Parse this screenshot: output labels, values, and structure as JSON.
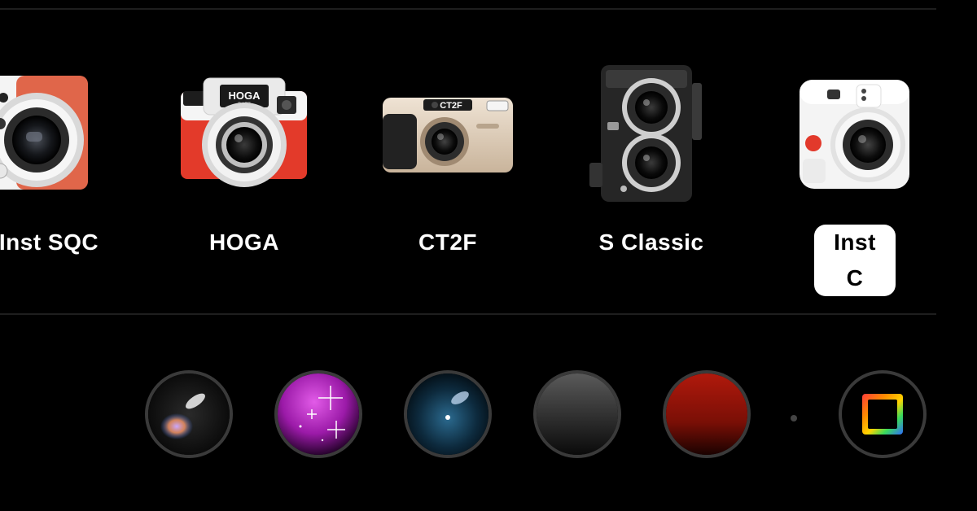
{
  "cameras": [
    {
      "id": "inst-sqc",
      "label": "Inst SQC",
      "selected": false
    },
    {
      "id": "hoga",
      "label": "HOGA",
      "badge": "HOGA",
      "selected": false
    },
    {
      "id": "ct2f",
      "label": "CT2F",
      "badge": "CT2F",
      "selected": false
    },
    {
      "id": "s-classic",
      "label": "S Classic",
      "selected": false
    },
    {
      "id": "inst-c",
      "label": "Inst C",
      "selected": true
    }
  ],
  "filters": [
    {
      "name": "light-leak-lens-filter",
      "icon": "iridescent-glare-icon"
    },
    {
      "name": "sparkle-lens-filter",
      "icon": "purple-sparkle-icon"
    },
    {
      "name": "blue-star-lens-filter",
      "icon": "blue-lens-icon"
    },
    {
      "name": "gray-lens-filter",
      "icon": "gray-lens-icon"
    },
    {
      "name": "red-lens-filter",
      "icon": "red-lens-icon"
    },
    {
      "name": "rainbow-frame-filter",
      "icon": "rainbow-frame-icon"
    }
  ],
  "colors": {
    "background": "#000000",
    "label_text": "#ffffff",
    "selected_pill": "#ffffff",
    "selected_text": "#000000",
    "button_ring": "#3a3a3a"
  }
}
